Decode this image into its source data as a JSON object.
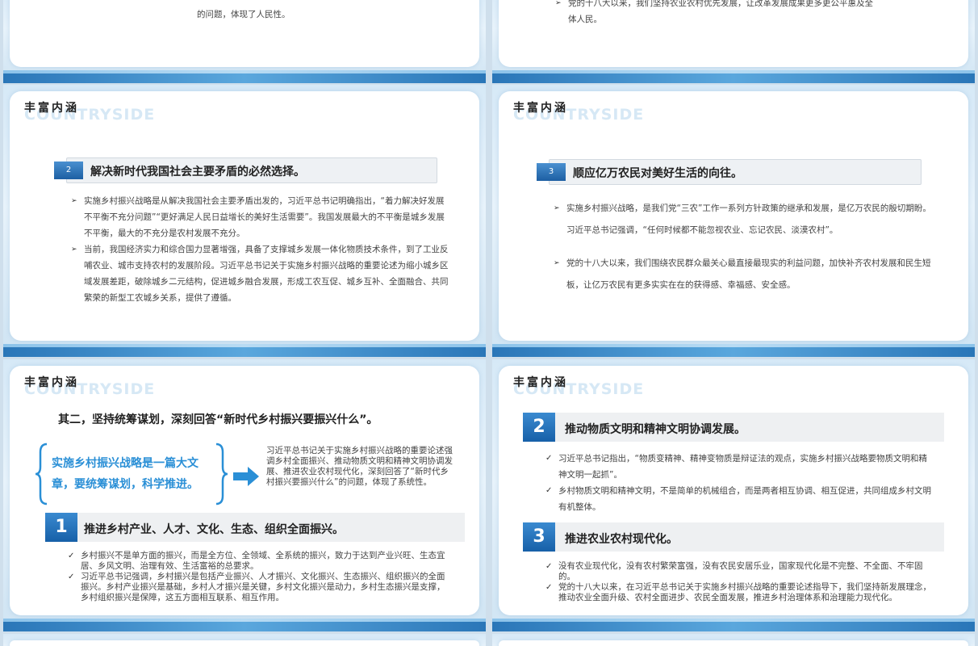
{
  "common": {
    "section_title": "丰富内涵",
    "watermark": "COUNTRYSIDE"
  },
  "top_left": {
    "text": "的问题，体现了人民性。"
  },
  "top_right": {
    "text1": "党的十八大以来，我们坚持农业农村优先发展，让改革发展成果更多更公平惠及全",
    "text2": "体人民。"
  },
  "mid_left": {
    "badge": "2",
    "heading": "解决新时代我国社会主要矛盾的必然选择。",
    "bullets": [
      "实施乡村振兴战略是从解决我国社会主要矛盾出发的，习近平总书记明确指出，“着力解决好发展不平衡不充分问题”“更好满足人民日益增长的美好生活需要”。我国发展最大的不平衡是城乡发展不平衡，最大的不充分是农村发展不充分。",
      "当前，我国经济实力和综合国力显著增强，具备了支撑城乡发展一体化物质技术条件，到了工业反哺农业、城市支持农村的发展阶段。习近平总书记关于实施乡村振兴战略的重要论述为缩小城乡区域发展差距，破除城乡二元结构，促进城乡融合发展，形成工农互促、城乡互补、全面融合、共同繁荣的新型工农城乡关系，提供了遵循。"
    ]
  },
  "mid_right": {
    "badge": "3",
    "heading": "顺应亿万农民对美好生活的向往。",
    "bullets": [
      "实施乡村振兴战略，是我们党“三农”工作一系列方针政策的继承和发展，是亿万农民的殷切期盼。习近平总书记强调，“任何时候都不能忽视农业、忘记农民、淡漠农村”。",
      "党的十八大以来，我们围绕农民群众最关心最直接最现实的利益问题，加快补齐农村发展和民生短板，让亿万农民有更多实实在在的获得感、幸福感、安全感。"
    ]
  },
  "bot_left": {
    "title": "其二，坚持统筹谋划，深刻回答“新时代乡村振兴要振兴什么”。",
    "brace_text": "实施乡村振兴战略是一篇大文章，要统筹谋划，科学推进。",
    "side_text": "习近平总书记关于实施乡村振兴战略的重要论述强调乡村全面振兴、推动物质文明和精神文明协调发展、推进农业农村现代化，深刻回答了“新时代乡村振兴要振兴什么”的问题，体现了系统性。",
    "item_num": "1",
    "item_heading": "推进乡村产业、人才、文化、生态、组织全面振兴。",
    "bullets": [
      "乡村振兴不是单方面的振兴，而是全方位、全领域、全系统的振兴，致力于达到产业兴旺、生态宜居、乡风文明、治理有效、生活富裕的总要求。",
      "习近平总书记强调，乡村振兴是包括产业振兴、人才振兴、文化振兴、生态振兴、组织振兴的全面振兴。乡村产业振兴是基础，乡村人才振兴是关键，乡村文化振兴是动力，乡村生态振兴是支撑，乡村组织振兴是保障，这五方面相互联系、相互作用。"
    ]
  },
  "bot_right": {
    "item2_num": "2",
    "item2_heading": "推动物质文明和精神文明协调发展。",
    "item2_bullets": [
      "习近平总书记指出，“物质变精神、精神变物质是辩证法的观点，实施乡村振兴战略要物质文明和精神文明一起抓”。",
      "乡村物质文明和精神文明，不是简单的机械组合，而是两者相互协调、相互促进，共同组成乡村文明有机整体。"
    ],
    "item3_num": "3",
    "item3_heading": "推进农业农村现代化。",
    "item3_bullets": [
      "没有农业现代化，没有农村繁荣富强，没有农民安居乐业，国家现代化是不完整、不全面、不牢固的。",
      "党的十八大以来，在习近平总书记关于实施乡村振兴战略的重要论述指导下，我们坚持新发展理念，推动农业全面升级、农村全面进步、农民全面发展，推进乡村治理体系和治理能力现代化。"
    ]
  },
  "colors": {
    "accent": "#1d6fb8",
    "highlight": "#2a8fd6"
  }
}
